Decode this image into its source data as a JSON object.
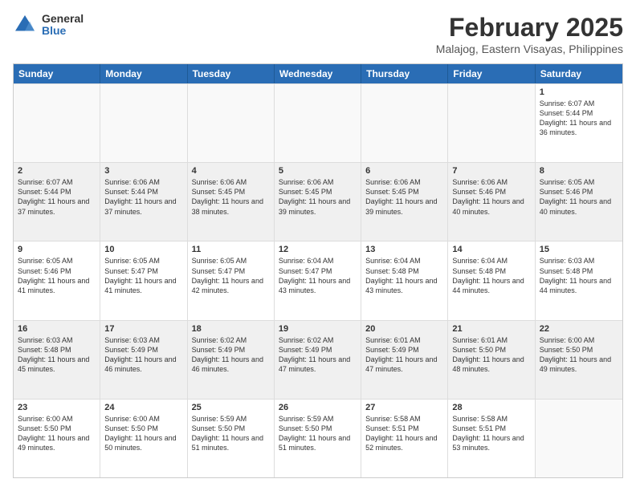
{
  "logo": {
    "general": "General",
    "blue": "Blue"
  },
  "title": "February 2025",
  "subtitle": "Malajog, Eastern Visayas, Philippines",
  "days": [
    "Sunday",
    "Monday",
    "Tuesday",
    "Wednesday",
    "Thursday",
    "Friday",
    "Saturday"
  ],
  "weeks": [
    [
      {
        "day": "",
        "empty": true
      },
      {
        "day": "",
        "empty": true
      },
      {
        "day": "",
        "empty": true
      },
      {
        "day": "",
        "empty": true
      },
      {
        "day": "",
        "empty": true
      },
      {
        "day": "",
        "empty": true
      },
      {
        "day": "1",
        "sunrise": "6:07 AM",
        "sunset": "5:44 PM",
        "daylight": "11 hours and 36 minutes."
      }
    ],
    [
      {
        "day": "2",
        "sunrise": "6:07 AM",
        "sunset": "5:44 PM",
        "daylight": "11 hours and 37 minutes."
      },
      {
        "day": "3",
        "sunrise": "6:06 AM",
        "sunset": "5:44 PM",
        "daylight": "11 hours and 37 minutes."
      },
      {
        "day": "4",
        "sunrise": "6:06 AM",
        "sunset": "5:45 PM",
        "daylight": "11 hours and 38 minutes."
      },
      {
        "day": "5",
        "sunrise": "6:06 AM",
        "sunset": "5:45 PM",
        "daylight": "11 hours and 39 minutes."
      },
      {
        "day": "6",
        "sunrise": "6:06 AM",
        "sunset": "5:45 PM",
        "daylight": "11 hours and 39 minutes."
      },
      {
        "day": "7",
        "sunrise": "6:06 AM",
        "sunset": "5:46 PM",
        "daylight": "11 hours and 40 minutes."
      },
      {
        "day": "8",
        "sunrise": "6:05 AM",
        "sunset": "5:46 PM",
        "daylight": "11 hours and 40 minutes."
      }
    ],
    [
      {
        "day": "9",
        "sunrise": "6:05 AM",
        "sunset": "5:46 PM",
        "daylight": "11 hours and 41 minutes."
      },
      {
        "day": "10",
        "sunrise": "6:05 AM",
        "sunset": "5:47 PM",
        "daylight": "11 hours and 41 minutes."
      },
      {
        "day": "11",
        "sunrise": "6:05 AM",
        "sunset": "5:47 PM",
        "daylight": "11 hours and 42 minutes."
      },
      {
        "day": "12",
        "sunrise": "6:04 AM",
        "sunset": "5:47 PM",
        "daylight": "11 hours and 43 minutes."
      },
      {
        "day": "13",
        "sunrise": "6:04 AM",
        "sunset": "5:48 PM",
        "daylight": "11 hours and 43 minutes."
      },
      {
        "day": "14",
        "sunrise": "6:04 AM",
        "sunset": "5:48 PM",
        "daylight": "11 hours and 44 minutes."
      },
      {
        "day": "15",
        "sunrise": "6:03 AM",
        "sunset": "5:48 PM",
        "daylight": "11 hours and 44 minutes."
      }
    ],
    [
      {
        "day": "16",
        "sunrise": "6:03 AM",
        "sunset": "5:48 PM",
        "daylight": "11 hours and 45 minutes."
      },
      {
        "day": "17",
        "sunrise": "6:03 AM",
        "sunset": "5:49 PM",
        "daylight": "11 hours and 46 minutes."
      },
      {
        "day": "18",
        "sunrise": "6:02 AM",
        "sunset": "5:49 PM",
        "daylight": "11 hours and 46 minutes."
      },
      {
        "day": "19",
        "sunrise": "6:02 AM",
        "sunset": "5:49 PM",
        "daylight": "11 hours and 47 minutes."
      },
      {
        "day": "20",
        "sunrise": "6:01 AM",
        "sunset": "5:49 PM",
        "daylight": "11 hours and 47 minutes."
      },
      {
        "day": "21",
        "sunrise": "6:01 AM",
        "sunset": "5:50 PM",
        "daylight": "11 hours and 48 minutes."
      },
      {
        "day": "22",
        "sunrise": "6:00 AM",
        "sunset": "5:50 PM",
        "daylight": "11 hours and 49 minutes."
      }
    ],
    [
      {
        "day": "23",
        "sunrise": "6:00 AM",
        "sunset": "5:50 PM",
        "daylight": "11 hours and 49 minutes."
      },
      {
        "day": "24",
        "sunrise": "6:00 AM",
        "sunset": "5:50 PM",
        "daylight": "11 hours and 50 minutes."
      },
      {
        "day": "25",
        "sunrise": "5:59 AM",
        "sunset": "5:50 PM",
        "daylight": "11 hours and 51 minutes."
      },
      {
        "day": "26",
        "sunrise": "5:59 AM",
        "sunset": "5:50 PM",
        "daylight": "11 hours and 51 minutes."
      },
      {
        "day": "27",
        "sunrise": "5:58 AM",
        "sunset": "5:51 PM",
        "daylight": "11 hours and 52 minutes."
      },
      {
        "day": "28",
        "sunrise": "5:58 AM",
        "sunset": "5:51 PM",
        "daylight": "11 hours and 53 minutes."
      },
      {
        "day": "",
        "empty": true
      }
    ]
  ]
}
